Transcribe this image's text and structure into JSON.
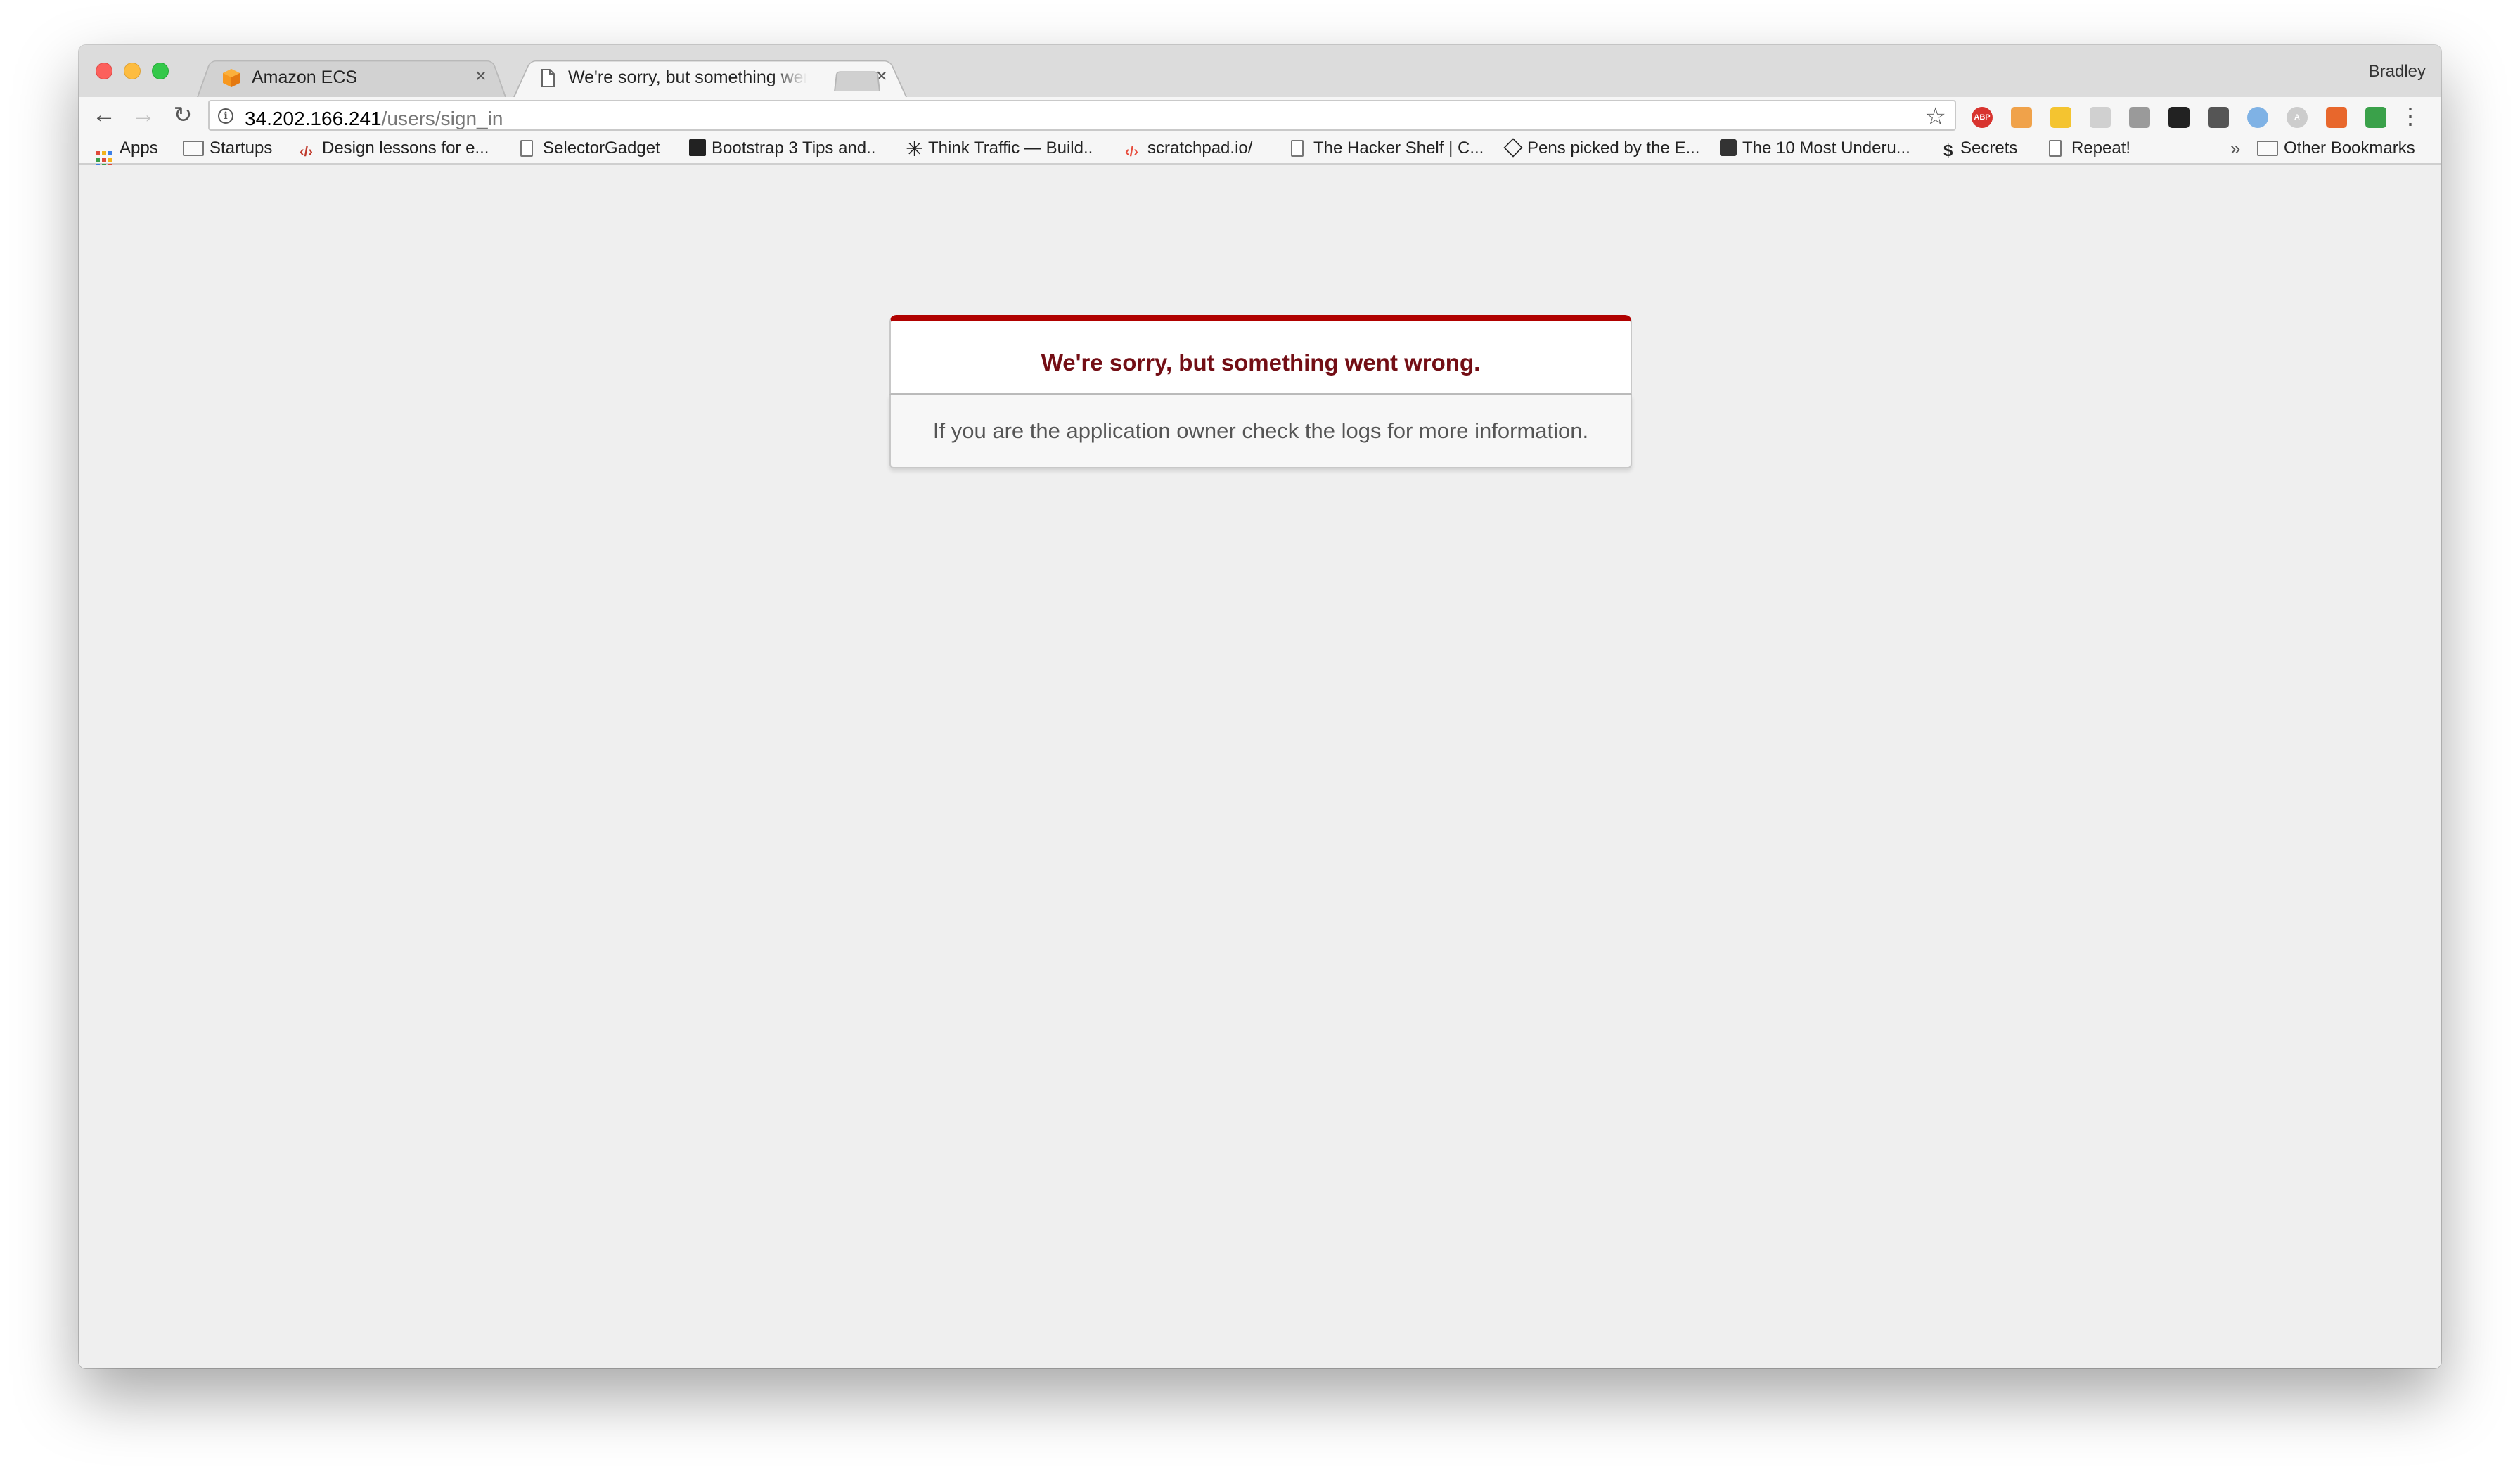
{
  "browser": {
    "profile_name": "Bradley",
    "tabs": [
      {
        "title": "Amazon ECS",
        "favicon": "aws-ecs-cube-icon",
        "active": false
      },
      {
        "title": "We're sorry, but something went wrong",
        "favicon": "document-icon",
        "active": true
      }
    ],
    "address": {
      "host": "34.202.166.241",
      "path": "/users/sign_in"
    },
    "extensions": [
      {
        "name": "adblock-plus-icon",
        "label": "ABP",
        "color": "#d8342f"
      },
      {
        "name": "extension-face-icon",
        "label": "",
        "color": "#f0a24a"
      },
      {
        "name": "extension-yellow-icon",
        "label": "",
        "color": "#f4c430"
      },
      {
        "name": "extension-chat-icon",
        "label": "",
        "color": "#d0d0d0"
      },
      {
        "name": "extension-gray-icon",
        "label": "",
        "color": "#9a9a9a"
      },
      {
        "name": "extension-wave-icon",
        "label": "",
        "color": "#222222"
      },
      {
        "name": "pocket-icon",
        "label": "",
        "color": "#555555"
      },
      {
        "name": "extension-snowflake-icon",
        "label": "",
        "color": "#7fb2e5"
      },
      {
        "name": "extension-a-icon",
        "label": "A",
        "color": "#cccccc"
      },
      {
        "name": "extension-orange-icon",
        "label": "",
        "color": "#e8672c"
      },
      {
        "name": "extension-green-search-icon",
        "label": "",
        "color": "#3aa14a"
      }
    ],
    "bookmarks": [
      {
        "label": "Apps",
        "icon": "apps-grid-icon"
      },
      {
        "label": "Startups",
        "icon": "folder-icon"
      },
      {
        "label": "Design lessons for e...",
        "icon": "code-icon"
      },
      {
        "label": "SelectorGadget",
        "icon": "document-icon"
      },
      {
        "label": "Bootstrap 3 Tips and..",
        "icon": "bootstrap-icon"
      },
      {
        "label": "Think Traffic — Build..",
        "icon": "asterisk-icon"
      },
      {
        "label": "scratchpad.io/",
        "icon": "code-icon"
      },
      {
        "label": "The Hacker Shelf | C...",
        "icon": "document-icon"
      },
      {
        "label": "Pens picked by the E...",
        "icon": "codepen-icon"
      },
      {
        "label": "The 10 Most Underu...",
        "icon": "box-icon"
      },
      {
        "label": "Secrets",
        "icon": "dollar-icon"
      },
      {
        "label": "Repeat!",
        "icon": "document-icon"
      }
    ],
    "other_bookmarks": "Other Bookmarks",
    "overflow_glyph": "»"
  },
  "page": {
    "error_title": "We're sorry, but something went wrong.",
    "error_message": "If you are the application owner check the logs for more information.",
    "accent_color": "#b00100",
    "title_color": "#730e15"
  }
}
